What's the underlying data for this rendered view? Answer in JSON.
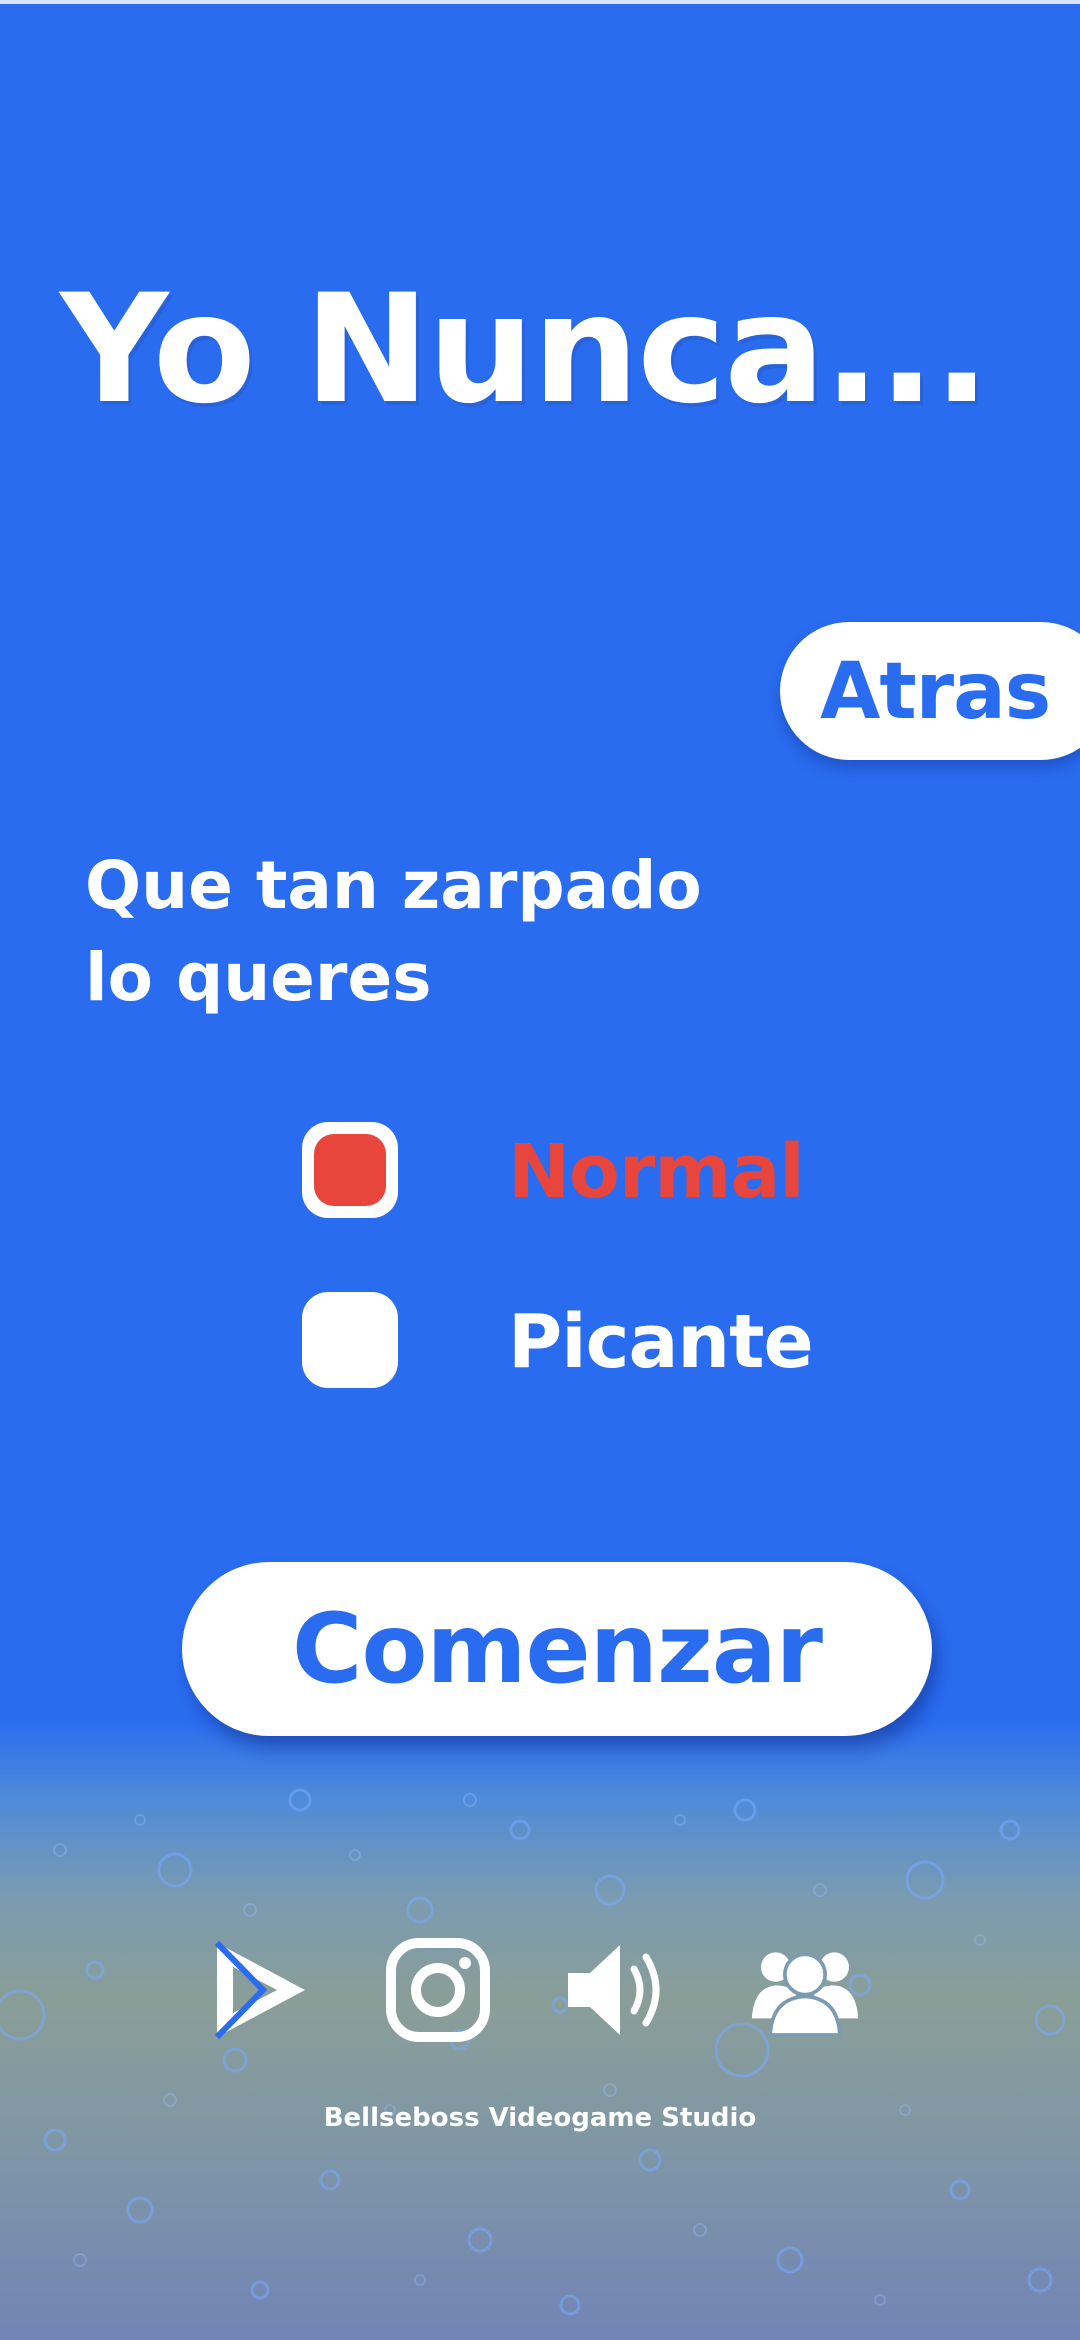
{
  "app": {
    "title": "Yo Nunca..."
  },
  "header": {
    "back_label": "Atras"
  },
  "question": {
    "text": "Que tan zarpado\nlo queres"
  },
  "options": [
    {
      "label": "Normal",
      "selected": true,
      "color": "#e8453c"
    },
    {
      "label": "Picante",
      "selected": false,
      "color": "#ffffff"
    }
  ],
  "start_button": {
    "label": "Comenzar"
  },
  "footer": {
    "icons": [
      "play-store-icon",
      "instagram-icon",
      "sound-icon",
      "community-icon"
    ],
    "credit": "Bellseboss Videogame Studio"
  },
  "colors": {
    "background": "#2a6cf0",
    "accent_selected": "#e8453c",
    "button_bg": "#ffffff",
    "button_text": "#2a6cf0"
  }
}
